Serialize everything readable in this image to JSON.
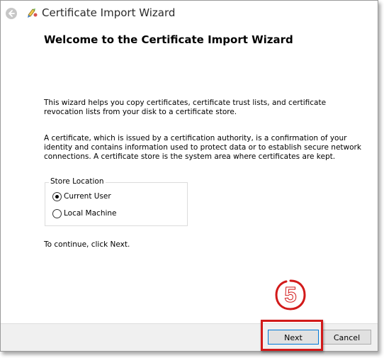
{
  "window": {
    "title": "Certificate Import Wizard"
  },
  "titlebar": {
    "back_icon": "back-arrow-icon",
    "app_icon": "certificate-icon"
  },
  "main": {
    "heading": "Welcome to the Certificate Import Wizard",
    "paragraph1": "This wizard helps you copy certificates, certificate trust lists, and certificate revocation lists from your disk to a certificate store.",
    "paragraph2": "A certificate, which is issued by a certification authority, is a confirmation of your identity and contains information used to protect data or to establish secure network connections. A certificate store is the system area where certificates are kept.",
    "store_location": {
      "legend": "Store Location",
      "options": [
        {
          "label": "Current User",
          "selected": true
        },
        {
          "label": "Local Machine",
          "selected": false
        }
      ]
    },
    "continue_text": "To continue, click Next."
  },
  "footer": {
    "next_label": "Next",
    "cancel_label": "Cancel"
  },
  "annotation": {
    "step_number": "5",
    "color": "#d21a1a"
  },
  "colors": {
    "accent": "#0078d7",
    "annotation_red": "#d21a1a",
    "footer_bg": "#f0f0f0"
  }
}
